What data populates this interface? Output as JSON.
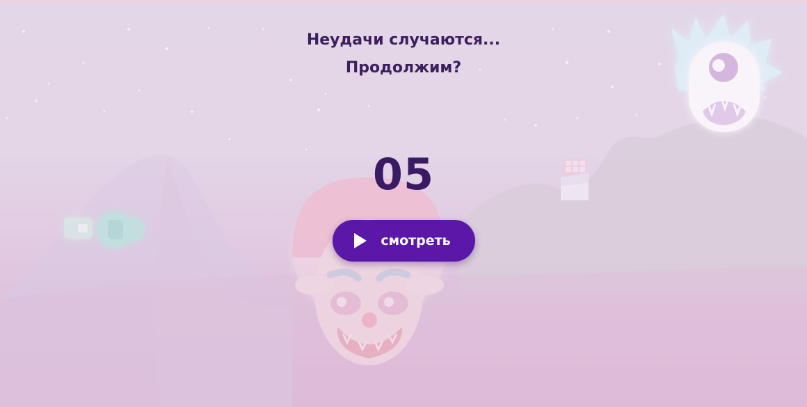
{
  "dialog": {
    "title_line1": "Неудачи случаются...",
    "title_line2": "Продолжим?",
    "countdown": "05",
    "watch_button_label": "смотреть",
    "watch_button_icon": "play-icon"
  },
  "colors": {
    "accent": "#5b17a8",
    "text": "#3c1f5e",
    "sky": "#dfd3e4",
    "ground": "#d39ec8"
  },
  "scene": {
    "characters": [
      "clown-head",
      "cyclops-monster",
      "ghost-character",
      "chocolate-bar"
    ]
  }
}
